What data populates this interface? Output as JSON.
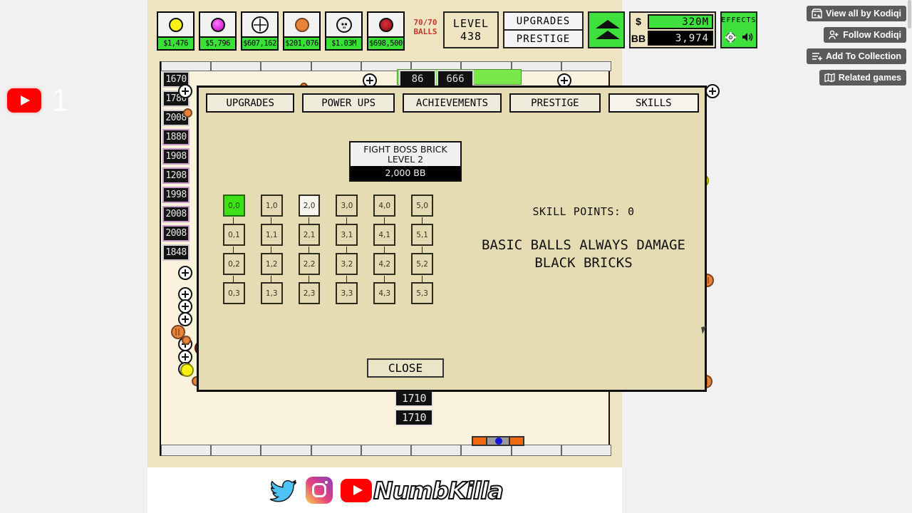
{
  "overlay": {
    "subscriber_count": "1",
    "icon": "youtube-play-icon"
  },
  "right_rail": {
    "buttons": [
      {
        "label": "View all by Kodiqi",
        "icon": "storefront-icon"
      },
      {
        "label": "Follow Kodiqi",
        "icon": "user-plus-icon"
      },
      {
        "label": "Add To Collection",
        "icon": "list-plus-icon"
      },
      {
        "label": "Related games",
        "icon": "map-icon"
      }
    ]
  },
  "hud": {
    "ball_types": [
      {
        "name": "yellow-ball",
        "color": "#f7f114",
        "value": "$1,476"
      },
      {
        "name": "magenta-ball",
        "color": "#e81ee8",
        "value": "$5,796"
      },
      {
        "name": "plus-ball",
        "color": "#ffffff",
        "value": "$607,162"
      },
      {
        "name": "orange-striped-ball",
        "color": "#e8833c",
        "value": "$201,076"
      },
      {
        "name": "skull-ball",
        "color": "#e8e8e8",
        "value": "$1.03M"
      },
      {
        "name": "red-ball",
        "color": "#a81020",
        "value": "$698,500"
      }
    ],
    "balls_counter": "70/70",
    "balls_label": "BALLS",
    "level_label": "LEVEL",
    "level_value": "438",
    "upgrades_label": "UPGRADES",
    "prestige_label": "PRESTIGE",
    "boost_icon": "double-chevron-up-icon",
    "money_label": "$",
    "money_value": "320M",
    "bb_label": "BB",
    "bb_value": "3,974",
    "effects_label": "EFFECTS",
    "gear_icon": "gear-icon",
    "sound_icon": "speaker-icon"
  },
  "board": {
    "brick_labels": [
      "1670",
      "1780",
      "2008",
      "1880",
      "1908",
      "1208",
      "1998",
      "2008",
      "2008",
      "1848"
    ],
    "score_tags": [
      "1710",
      "1710"
    ],
    "progress_tags": [
      "86",
      "666"
    ],
    "paddle": "paddle"
  },
  "modal": {
    "tabs": [
      {
        "label": "UPGRADES",
        "active": false
      },
      {
        "label": "POWER UPS",
        "active": false
      },
      {
        "label": "ACHIEVEMENTS",
        "active": false
      },
      {
        "label": "PRESTIGE",
        "active": false
      },
      {
        "label": "SKILLS",
        "active": true
      }
    ],
    "boss_button": {
      "line1": "FIGHT BOSS BRICK",
      "line2": "LEVEL 2",
      "cost": "2,000 BB"
    },
    "skill_grid": {
      "rows": [
        [
          "0,0",
          "1,0",
          "2,0",
          "3,0",
          "4,0",
          "5,0"
        ],
        [
          "0,1",
          "1,1",
          "2,1",
          "3,1",
          "4,1",
          "5,1"
        ],
        [
          "0,2",
          "1,2",
          "2,2",
          "3,2",
          "4,2",
          "5,2"
        ],
        [
          "0,3",
          "1,3",
          "2,3",
          "3,3",
          "4,3",
          "5,3"
        ]
      ],
      "unlocked": [
        "0,0"
      ],
      "hovered": [
        "2,0"
      ]
    },
    "skill_points_label": "SKILL POINTS: 0",
    "skill_description": "BASIC BALLS ALWAYS DAMAGE\nBLACK BRICKS",
    "close_label": "CLOSE"
  },
  "footer": {
    "brand": "NumbKilla",
    "socials": [
      "twitter-icon",
      "instagram-icon",
      "youtube-icon"
    ]
  },
  "colors": {
    "green": "#3ee03e",
    "board_bg": "#faf2dd",
    "frame_bg": "#eee4c2",
    "modal_bg": "#e5dcb4"
  }
}
